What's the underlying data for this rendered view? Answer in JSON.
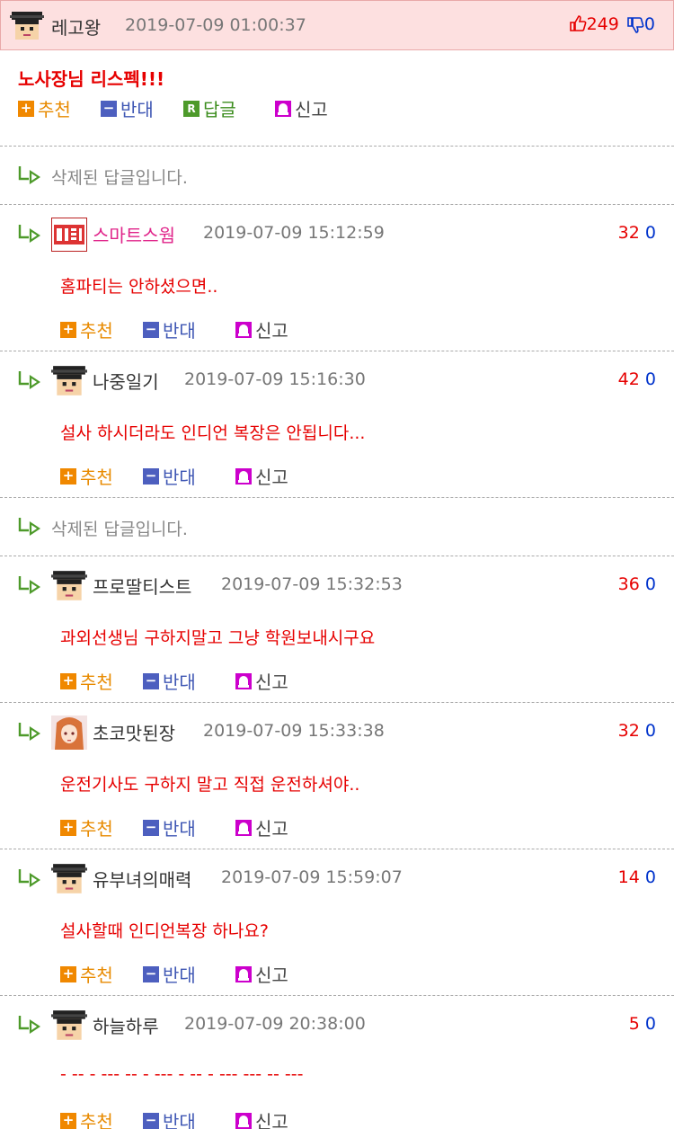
{
  "main": {
    "nick": "레고왕",
    "time": "2019-07-09 01:00:37",
    "up": "249",
    "down": "0",
    "body": "노사장님 리스펙!!!",
    "actions": {
      "recommend": "추천",
      "oppose": "반대",
      "reply": "답글",
      "report": "신고"
    }
  },
  "deleted_text": "삭제된 답글입니다.",
  "replies": [
    {
      "nick": "스마트스웜",
      "time": "2019-07-09 15:12:59",
      "up": "32",
      "down": "0",
      "body": "홈파티는 안하셨으면..",
      "nick_color": "#e0248a",
      "avatar": "logo"
    },
    {
      "nick": "나중일기",
      "time": "2019-07-09 15:16:30",
      "up": "42",
      "down": "0",
      "body": "설사 하시더라도 인디언 복장은 안됩니다...",
      "nick_color": "#333333",
      "avatar": "pixel"
    },
    {
      "nick": "프로딸티스트",
      "time": "2019-07-09 15:32:53",
      "up": "36",
      "down": "0",
      "body": "과외선생님 구하지말고 그냥 학원보내시구요",
      "nick_color": "#333333",
      "avatar": "pixel"
    },
    {
      "nick": "초코맛된장",
      "time": "2019-07-09 15:33:38",
      "up": "32",
      "down": "0",
      "body": "운전기사도 구하지 말고 직접 운전하셔야..",
      "nick_color": "#333333",
      "avatar": "anime"
    },
    {
      "nick": "유부녀의매력",
      "time": "2019-07-09 15:59:07",
      "up": "14",
      "down": "0",
      "body": "설사할때 인디언복장 하나요?",
      "nick_color": "#333333",
      "avatar": "pixel"
    },
    {
      "nick": "하늘하루",
      "time": "2019-07-09 20:38:00",
      "up": "5",
      "down": "0",
      "body": "- -- - --- -- - --- - -- - --- --- -- ---",
      "nick_color": "#333333",
      "avatar": "pixel"
    }
  ],
  "reply_actions": {
    "recommend": "추천",
    "oppose": "반대",
    "report": "신고"
  }
}
